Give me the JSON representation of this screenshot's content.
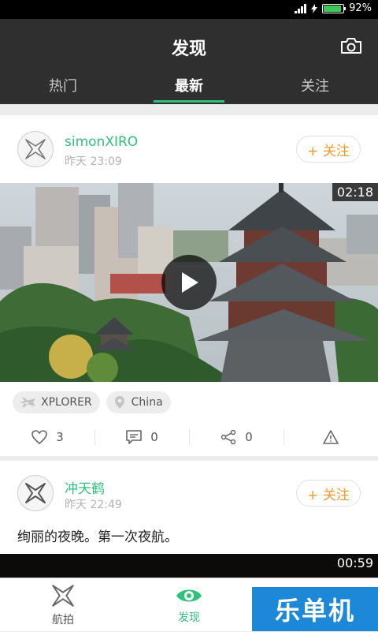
{
  "status_bar": {
    "battery": "92%",
    "battery_level": 0.92
  },
  "header": {
    "title": "发现",
    "camera_icon": "camera-icon"
  },
  "tabs": [
    {
      "label": "热门",
      "active": false
    },
    {
      "label": "最新",
      "active": true
    },
    {
      "label": "关注",
      "active": false
    }
  ],
  "posts": [
    {
      "username": "simonXIRO",
      "time": "昨天 23:09",
      "follow_label": "+ 关注",
      "duration": "02:18",
      "tags": [
        {
          "icon": "drone-icon",
          "label": "XPLORER"
        },
        {
          "icon": "location-icon",
          "label": "China"
        }
      ],
      "likes": "3",
      "comments": "0",
      "shares": "0"
    },
    {
      "username": "冲天鹤",
      "time": "昨天 22:49",
      "follow_label": "+ 关注",
      "text": "绚丽的夜晚。第一次夜航。",
      "duration": "00:59"
    }
  ],
  "bottom_nav": [
    {
      "label": "航拍",
      "icon": "drone-icon",
      "active": false
    },
    {
      "label": "发现",
      "icon": "eye-icon",
      "active": true
    }
  ],
  "watermark": "乐单机",
  "colors": {
    "accent": "#2fc27b",
    "follow": "#f29a26",
    "header_bg": "#2f2f2f"
  }
}
